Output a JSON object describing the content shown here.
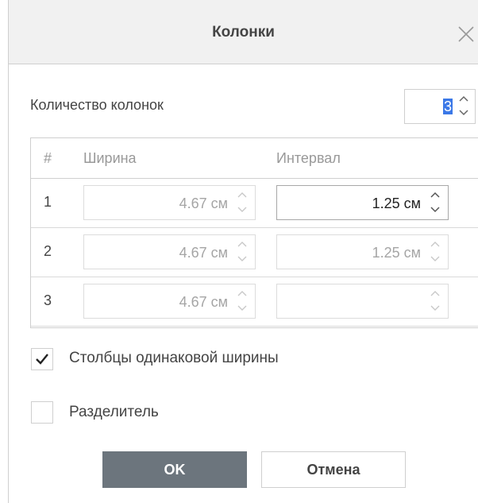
{
  "dialog": {
    "title": "Колонки",
    "count_label": "Количество колонок",
    "count_value": "3",
    "table": {
      "headers": [
        "#",
        "Ширина",
        "Интервал"
      ],
      "rows": [
        {
          "num": "1",
          "width": "4.67 см",
          "spacing": "1.25 см"
        },
        {
          "num": "2",
          "width": "4.67 см",
          "spacing": "1.25 см"
        },
        {
          "num": "3",
          "width": "4.67 см",
          "spacing": ""
        }
      ]
    },
    "equal_width_label": "Столбцы одинаковой ширины",
    "equal_width_checked": true,
    "separator_label": "Разделитель",
    "separator_checked": false,
    "ok_label": "OK",
    "cancel_label": "Отмена"
  },
  "colors": {
    "ok_button": "#6c757d",
    "selection": "#3b78e7",
    "disabled_text": "#a5a5a5"
  },
  "icons": [
    "close-icon",
    "chevron-up-icon",
    "chevron-down-icon",
    "checkmark-icon"
  ]
}
